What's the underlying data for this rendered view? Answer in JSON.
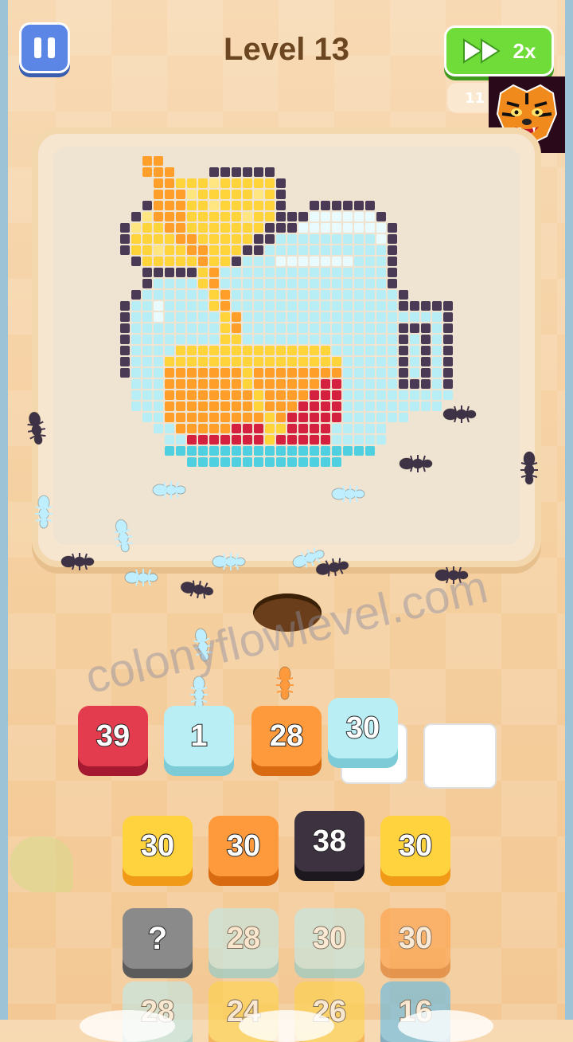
{
  "header": {
    "level_title": "Level 13",
    "speed_label": "2x",
    "timer_text": "11"
  },
  "icons": {
    "pause": "pause-icon",
    "fast_forward": "fast-forward-icon",
    "tiger_logo": "tiger-logo"
  },
  "watermark": "colonyflowlevel.com",
  "slots": [
    {
      "value": "39",
      "color": "red"
    },
    {
      "value": "1",
      "color": "cyan"
    },
    {
      "value": "28",
      "color": "orange"
    },
    {
      "value": "30",
      "color": "cyan"
    },
    {
      "value": "",
      "color": "empty"
    }
  ],
  "grid_rows": [
    [
      {
        "value": "30",
        "color": "yellow"
      },
      {
        "value": "30",
        "color": "orange"
      },
      {
        "value": "38",
        "color": "dark"
      },
      {
        "value": "30",
        "color": "yellow"
      }
    ],
    [
      {
        "value": "?",
        "color": "gray"
      },
      {
        "value": "28",
        "color": "cyan"
      },
      {
        "value": "30",
        "color": "cyan"
      },
      {
        "value": "30",
        "color": "orange"
      }
    ],
    [
      {
        "value": "28",
        "color": "cyan"
      },
      {
        "value": "24",
        "color": "yellow"
      },
      {
        "value": "26",
        "color": "yellow"
      },
      {
        "value": "16",
        "color": "blue"
      }
    ]
  ],
  "colors": {
    "pause_button": "#5b86e6",
    "speed_button": "#6fdc3a",
    "title_text": "#6b4620"
  }
}
